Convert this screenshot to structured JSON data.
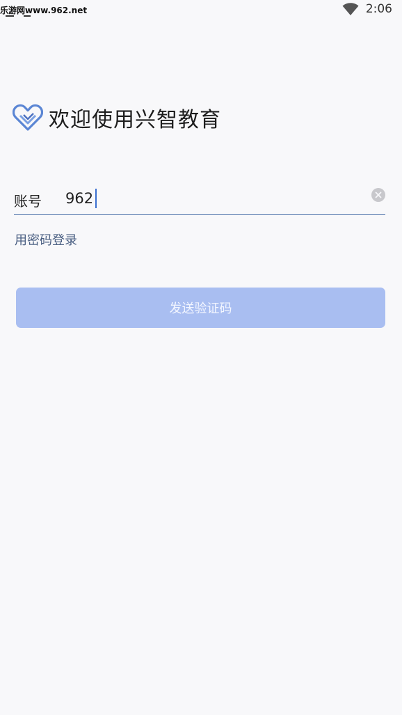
{
  "status_bar": {
    "watermark_site": "乐游网",
    "watermark_url": "www.962.net",
    "time": "2:06"
  },
  "welcome": {
    "title": "欢迎使用兴智教育"
  },
  "account": {
    "label": "账号",
    "value": "962"
  },
  "password_login_link": "用密码登录",
  "send_code_button": "发送验证码",
  "colors": {
    "background": "#f8f8fa",
    "primary_disabled": "#a9bef1",
    "link": "#4a5f82",
    "underline": "#4a6fa8"
  }
}
